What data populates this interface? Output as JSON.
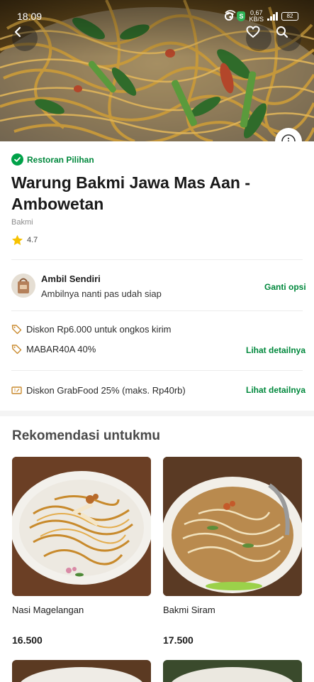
{
  "status_bar": {
    "time": "18.09",
    "speed_value": "0,67",
    "speed_unit": "KB/S",
    "battery": "82"
  },
  "hero": {
    "image": "fried noodles with greens (bakmi goreng)",
    "icons": [
      "back-arrow-icon",
      "heart-icon",
      "search-icon",
      "info-icon"
    ]
  },
  "restaurant": {
    "badge": "Restoran Pilihan",
    "name": "Warung Bakmi Jawa Mas Aan - Ambowetan",
    "cuisine": "Bakmi",
    "rating": "4.7"
  },
  "delivery": {
    "mode_title": "Ambil Sendiri",
    "mode_subtitle": "Ambilnya nanti pas udah siap",
    "change_label": "Ganti opsi"
  },
  "promos": [
    {
      "icon": "tag-icon",
      "text": "Diskon Rp6.000 untuk ongkos kirim",
      "link": ""
    },
    {
      "icon": "tag-icon",
      "text": "MABAR40A 40%",
      "link": "Lihat detailnya"
    },
    {
      "icon": "coupon-icon",
      "text": "Diskon GrabFood 25% (maks. Rp40rb)",
      "link": "Lihat detailnya"
    }
  ],
  "recommendations": {
    "title": "Rekomendasi untukmu",
    "items": [
      {
        "name": "Nasi Magelangan",
        "price": "16.500"
      },
      {
        "name": "Bakmi Siram",
        "price": "17.500"
      }
    ]
  },
  "colors": {
    "accent_green": "#00883c",
    "badge_green": "#00a249",
    "star": "#f7c200"
  }
}
